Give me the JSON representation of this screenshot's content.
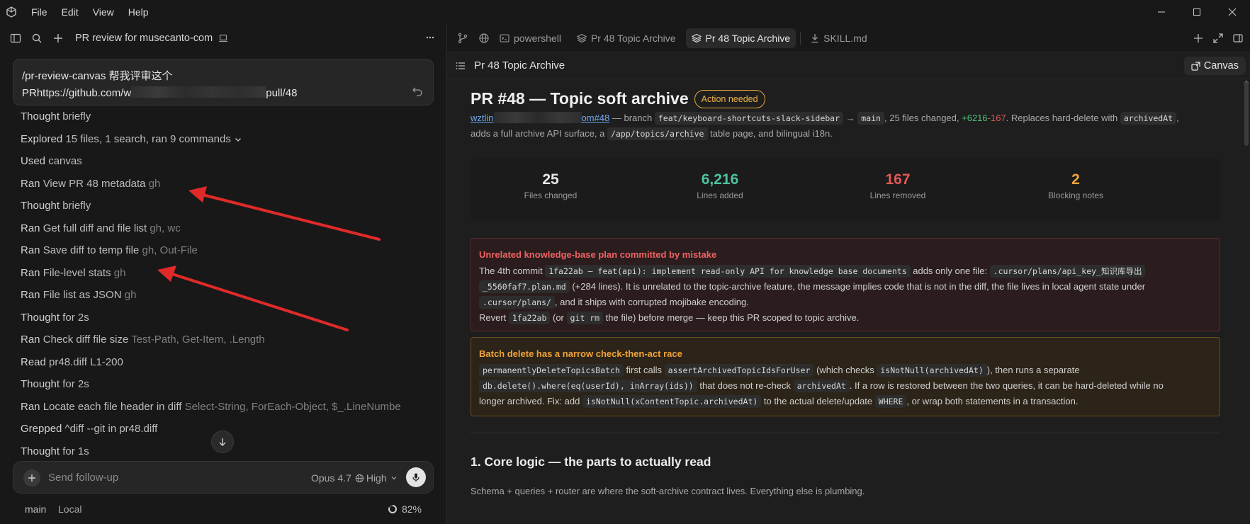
{
  "menu": {
    "items": [
      "File",
      "Edit",
      "View",
      "Help"
    ]
  },
  "left": {
    "chat_title": "PR review for musecanto-com",
    "prompt": {
      "line1": "/pr-review-canvas 帮我评审这个",
      "line2_prefix": "PRhttps://github.com/w",
      "line2_suffix": "pull/48"
    },
    "transcript": [
      {
        "verb": "Thought",
        "label": "briefly",
        "detail": ""
      },
      {
        "verb": "Explored",
        "label": "15 files, 1 search, ran 9 commands",
        "detail": ""
      },
      {
        "verb": "Used",
        "label": "canvas",
        "detail": ""
      },
      {
        "verb": "Ran",
        "label": "View PR 48 metadata",
        "detail": "gh"
      },
      {
        "verb": "Thought",
        "label": "briefly",
        "detail": ""
      },
      {
        "verb": "Ran",
        "label": "Get full diff and file list",
        "detail": "gh, wc"
      },
      {
        "verb": "Ran",
        "label": "Save diff to temp file",
        "detail": "gh, Out-File"
      },
      {
        "verb": "Ran",
        "label": "File-level stats",
        "detail": "gh"
      },
      {
        "verb": "Ran",
        "label": "File list as JSON",
        "detail": "gh"
      },
      {
        "verb": "Thought",
        "label": "for 2s",
        "detail": ""
      },
      {
        "verb": "Ran",
        "label": "Check diff file size",
        "detail": "Test-Path, Get-Item, .Length"
      },
      {
        "verb": "Read",
        "label": "pr48.diff L1-200",
        "detail": ""
      },
      {
        "verb": "Thought",
        "label": "for 2s",
        "detail": ""
      },
      {
        "verb": "Ran",
        "label": "Locate each file header in diff",
        "detail": "Select-String, ForEach-Object, $_.LineNumbe"
      },
      {
        "verb": "Grepped",
        "label": "^diff --git in pr48.diff",
        "detail": ""
      },
      {
        "verb": "Thought",
        "label": "for 1s",
        "detail": ""
      }
    ],
    "composer": {
      "placeholder": "Send follow-up",
      "model": "Opus 4.7",
      "effort": "High"
    },
    "status": {
      "branch": "main",
      "location": "Local",
      "context": "82%",
      "context_fraction": 0.82
    }
  },
  "right": {
    "tabs": [
      {
        "label": "powershell",
        "icon": "terminal-icon",
        "active": false
      },
      {
        "label": "Pr 48 Topic Archive",
        "icon": "layers-icon",
        "active": false
      },
      {
        "label": "Pr 48 Topic Archive",
        "icon": "layers-icon",
        "active": true
      },
      {
        "label": "SKILL.md",
        "icon": "download-icon",
        "active": false
      }
    ],
    "doc_header": "Pr 48 Topic Archive",
    "canvas_button": "Canvas",
    "doc": {
      "title": "PR #48 — Topic soft archive",
      "badge": "Action needed",
      "summary": {
        "link_prefix": "wztlin",
        "link_suffix": "om#48",
        "t1": " — branch ",
        "branch_from": "feat/keyboard-shortcuts-slack-sidebar",
        "arrow": " → ",
        "branch_to": "main",
        "t2": ", 25 files changed, ",
        "added": "+6216",
        "removed": "-167",
        "t3": ". Replaces hard-delete with ",
        "code1": "archivedAt",
        "t4": ",",
        "t5": "adds a full archive API surface, a ",
        "code2": "/app/topics/archive",
        "t6": " table page, and bilingual i18n."
      },
      "stats": [
        {
          "value": "25",
          "label": "Files changed",
          "color": "#e8e8e8"
        },
        {
          "value": "6,216",
          "label": "Lines added",
          "color": "#4ec3a0"
        },
        {
          "value": "167",
          "label": "Lines removed",
          "color": "#e45757"
        },
        {
          "value": "2",
          "label": "Blocking notes",
          "color": "#f0a33a"
        }
      ],
      "callout1": {
        "title": "Unrelated knowledge-base plan committed by mistake",
        "a1": "The 4th commit ",
        "c1": "1fa22ab — feat(api): implement read-only API for knowledge base documents",
        "a2": " adds only one file: ",
        "c2": ".cursor/plans/api_key_知识库导出",
        "c3": "_5560faf7.plan.md",
        "a3": " (+284 lines). It is unrelated to the topic-archive feature, the message implies code that is not in the diff, the file lives in local agent state under",
        "c4": ".cursor/plans/",
        "a4": ", and it ships with corrupted mojibake encoding.",
        "b1": "Revert ",
        "c5": "1fa22ab",
        "b2": " (or ",
        "c6": "git rm",
        "b3": " the file) before merge — keep this PR scoped to topic archive."
      },
      "callout2": {
        "title": "Batch delete has a narrow check-then-act race",
        "c1": "permanentlyDeleteTopicsBatch",
        "a1": " first calls ",
        "c2": "assertArchivedTopicIdsForUser",
        "a2": " (which checks ",
        "c3": "isNotNull(archivedAt)",
        "a3": "), then runs a separate",
        "c4": "db.delete().where(eq(userId), inArray(ids))",
        "a4": " that does not re-check ",
        "c5": "archivedAt",
        "a5": ". If a row is restored between the two queries, it can be hard-deleted while no",
        "a6": "longer archived. Fix: add ",
        "c6": "isNotNull(xContentTopic.archivedAt)",
        "a7": " to the actual delete/update ",
        "c7": "WHERE",
        "a8": ", or wrap both statements in a transaction."
      },
      "section1_title": "1. Core logic — the parts to actually read",
      "section1_text": "Schema + queries + router are where the soft-archive contract lives. Everything else is plumbing."
    }
  }
}
